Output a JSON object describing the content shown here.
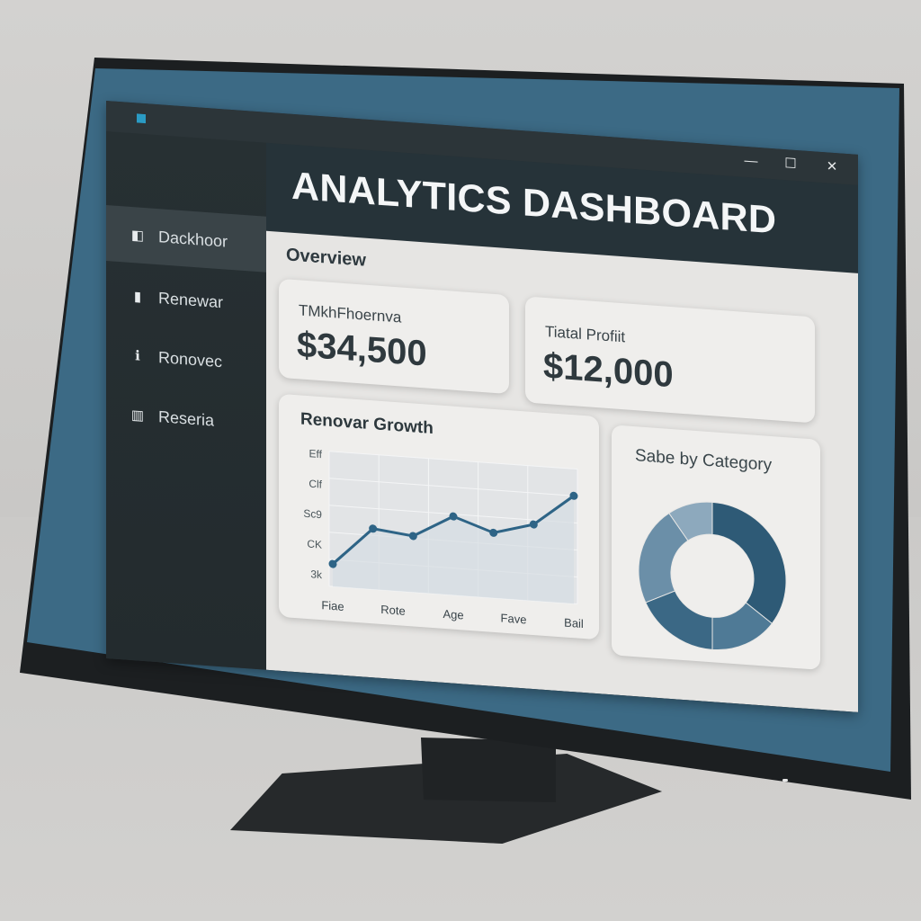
{
  "window": {
    "controls": [
      "—",
      "☐",
      "✕"
    ],
    "title": "ANALYTICS DASHBOARD"
  },
  "sidebar": {
    "items": [
      {
        "label": "Dackhoor",
        "icon": "dashboard-icon"
      },
      {
        "label": "Renewar",
        "icon": "report-icon"
      },
      {
        "label": "Ronovec",
        "icon": "info-icon"
      },
      {
        "label": "Reseria",
        "icon": "bar-chart-icon"
      }
    ]
  },
  "main": {
    "section_title": "Overview",
    "kpis": [
      {
        "label": "TMkhFhoernva",
        "value": "$34,500"
      },
      {
        "label": "Tiatal Profiit",
        "value": "$12,000"
      }
    ]
  },
  "chart_data": [
    {
      "type": "line",
      "title": "Renovar Growth",
      "categories": [
        "Fiae",
        "Rote",
        "Age",
        "Fave",
        "Bail"
      ],
      "y_tick_labels": [
        "Eff",
        "Clf",
        "Sc9",
        "CK",
        "3k"
      ],
      "series": [
        {
          "values": [
            1,
            2.7,
            2.5,
            3.5,
            2.9,
            3.4,
            4.8
          ]
        }
      ],
      "ylim": [
        0,
        6
      ],
      "grid": true,
      "color": "#2e6486"
    },
    {
      "type": "pie",
      "title": "Sabe by Category",
      "donut": true,
      "values": [
        35,
        15,
        18,
        22,
        10
      ],
      "colors": [
        "#2e5a76",
        "#4f7a96",
        "#3b6885",
        "#6b8fa8",
        "#8da9bd"
      ]
    }
  ]
}
